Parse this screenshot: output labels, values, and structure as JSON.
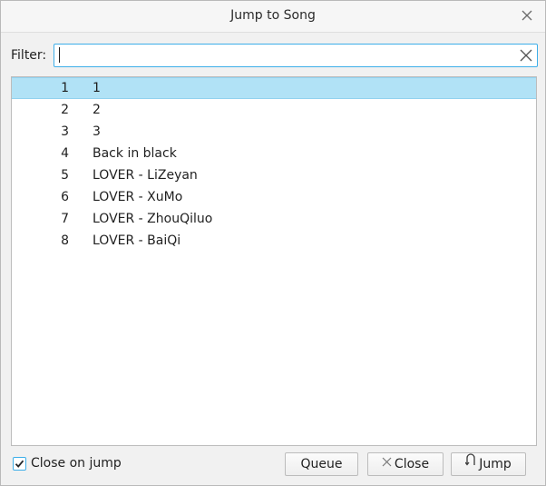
{
  "window": {
    "title": "Jump to Song"
  },
  "filter": {
    "label": "Filter:",
    "value": "",
    "placeholder": ""
  },
  "songs": [
    {
      "num": "1",
      "title": "1",
      "selected": true
    },
    {
      "num": "2",
      "title": "2",
      "selected": false
    },
    {
      "num": "3",
      "title": "3",
      "selected": false
    },
    {
      "num": "4",
      "title": "Back in black",
      "selected": false
    },
    {
      "num": "5",
      "title": "LOVER - LiZeyan",
      "selected": false
    },
    {
      "num": "6",
      "title": "LOVER - XuMo",
      "selected": false
    },
    {
      "num": "7",
      "title": "LOVER - ZhouQiluo",
      "selected": false
    },
    {
      "num": "8",
      "title": "LOVER - BaiQi",
      "selected": false
    }
  ],
  "footer": {
    "close_on_jump_label": "Close on jump",
    "close_on_jump_checked": true,
    "queue_label": "Queue",
    "close_label": "Close",
    "jump_label": "Jump"
  },
  "icons": {
    "titlebar_close": "close-icon",
    "filter_clear": "clear-icon",
    "close_button": "close-icon",
    "jump_button": "jump-icon",
    "checkbox": "checkmark-icon"
  },
  "colors": {
    "selection_bg": "#b1e2f6",
    "focus_border": "#3daee9",
    "window_bg": "#f1f1f1"
  }
}
